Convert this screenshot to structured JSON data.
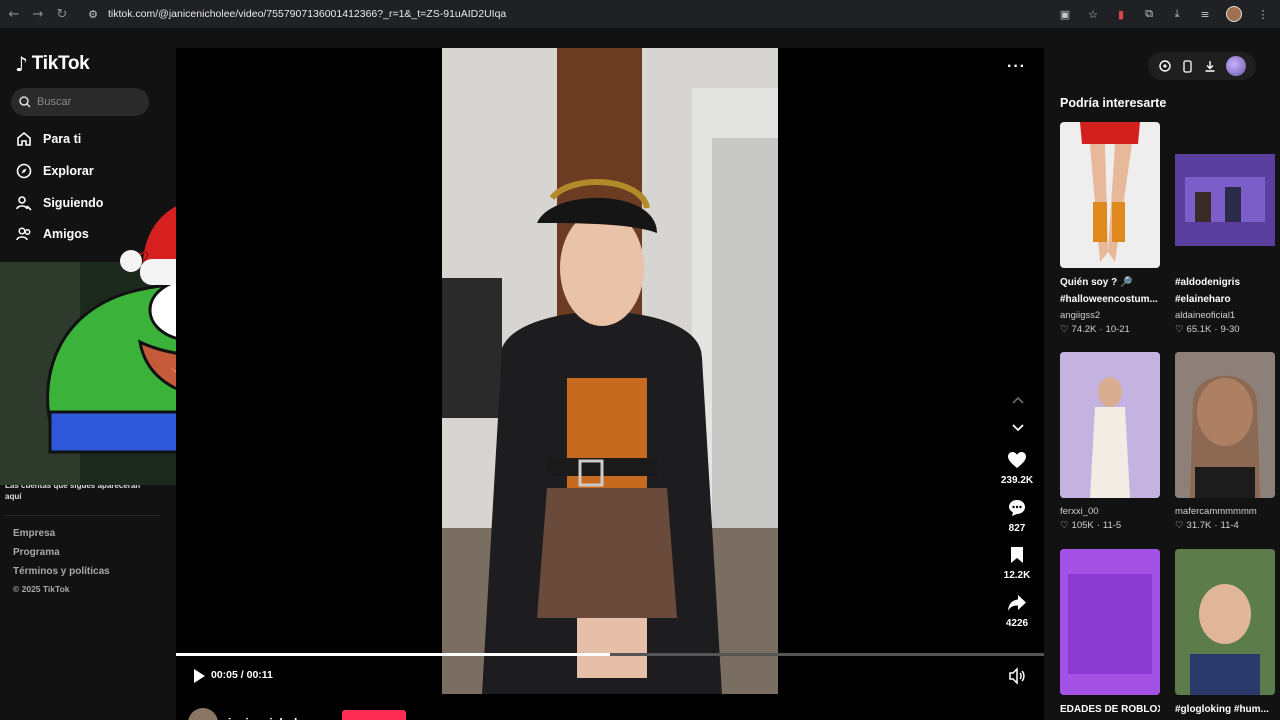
{
  "browser": {
    "url": "tiktok.com/@janicenicholee/video/7557907136001412366?_r=1&_t=ZS-91uAID2UIqa"
  },
  "sidebar": {
    "logo": "TikTok",
    "search_placeholder": "Buscar",
    "items": [
      {
        "label": "Para ti",
        "icon": "home-icon"
      },
      {
        "label": "Explorar",
        "icon": "compass-icon"
      },
      {
        "label": "Siguiendo",
        "icon": "user-follow-icon"
      },
      {
        "label": "Amigos",
        "icon": "friends-icon"
      }
    ],
    "note": "Las cuentas que sigues aparecerán aquí",
    "footer": [
      "Empresa",
      "Programa",
      "Términos y políticas"
    ],
    "copyright": "© 2025 TikTok"
  },
  "video": {
    "likes": "239.2K",
    "comments": "827",
    "saves": "12.2K",
    "shares": "4226",
    "time": "00:05 / 00:11",
    "progress": 0.5,
    "author": "janicenicholee"
  },
  "recommendations": {
    "title": "Podría interesarte",
    "items": [
      {
        "desc_line1": "Quién soy ? 🔎",
        "desc_line2": "#halloweencostum...",
        "user": "angiigss2",
        "likes": "74.2K",
        "date": "10-21"
      },
      {
        "desc_line1": "#aldodenigris",
        "desc_line2": "#elaineharo",
        "user": "aldaineoficial1",
        "likes": "65.1K",
        "date": "9-30"
      },
      {
        "desc_line1": "",
        "desc_line2": "",
        "user": "ferxxi_00",
        "likes": "105K",
        "date": "11-5"
      },
      {
        "desc_line1": "",
        "desc_line2": "",
        "user": "mafercammmmmm",
        "likes": "31.7K",
        "date": "11-4"
      },
      {
        "desc_line1": "EDADES DE ROBLOX",
        "desc_line2": "",
        "user": "",
        "likes": "",
        "date": ""
      },
      {
        "desc_line1": "#glogloking #hum...",
        "desc_line2": "",
        "user": "",
        "likes": "",
        "date": ""
      }
    ]
  },
  "colors": {
    "accent": "#fe2c55",
    "background": "#121212"
  }
}
